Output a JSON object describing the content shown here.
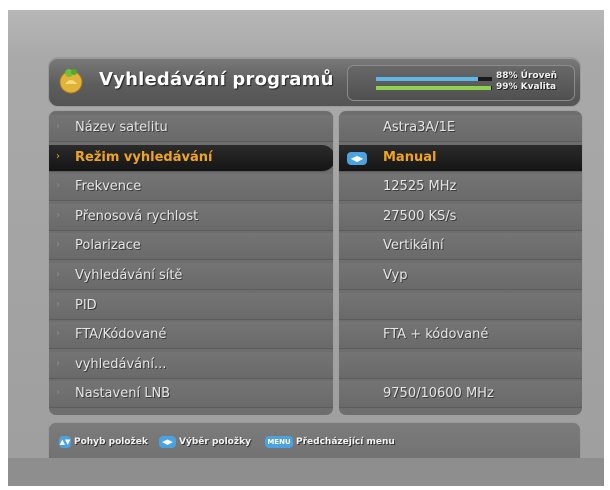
{
  "header": {
    "title": "Vyhledávání programů",
    "signal": {
      "level_pct": 88,
      "quality_pct": 99,
      "level_text": "88% Úroveň",
      "quality_text": "99% Kvalita"
    }
  },
  "menu": {
    "selected_index": 1,
    "items": [
      {
        "label": "Název satelitu",
        "value": "Astra3A/1E"
      },
      {
        "label": "Režim vyhledávání",
        "value": "Manual"
      },
      {
        "label": "Frekvence",
        "value": "12525 MHz"
      },
      {
        "label": "Přenosová rychlost",
        "value": "27500 KS/s"
      },
      {
        "label": "Polarizace",
        "value": "Vertikální"
      },
      {
        "label": "Vyhledávání sítě",
        "value": "Vyp"
      },
      {
        "label": "PID",
        "value": ""
      },
      {
        "label": "FTA/Kódované",
        "value": "FTA + kódované"
      },
      {
        "label": "vyhledávání...",
        "value": ""
      },
      {
        "label": "Nastavení LNB",
        "value": "9750/10600 MHz"
      }
    ]
  },
  "footer": {
    "hint1_icon": "updown-icon",
    "hint1_text": "Pohyb položek",
    "hint2_icon": "leftright-icon",
    "hint2_text": "Výběr položky",
    "hint3_icon_text": "MENU",
    "hint3_text": "Předcházející menu"
  },
  "colors": {
    "accent": "#f1a51b",
    "level_bar": "#5fb7e6",
    "quality_bar": "#8ed04f",
    "icon_blue": "#4aa3e0"
  }
}
